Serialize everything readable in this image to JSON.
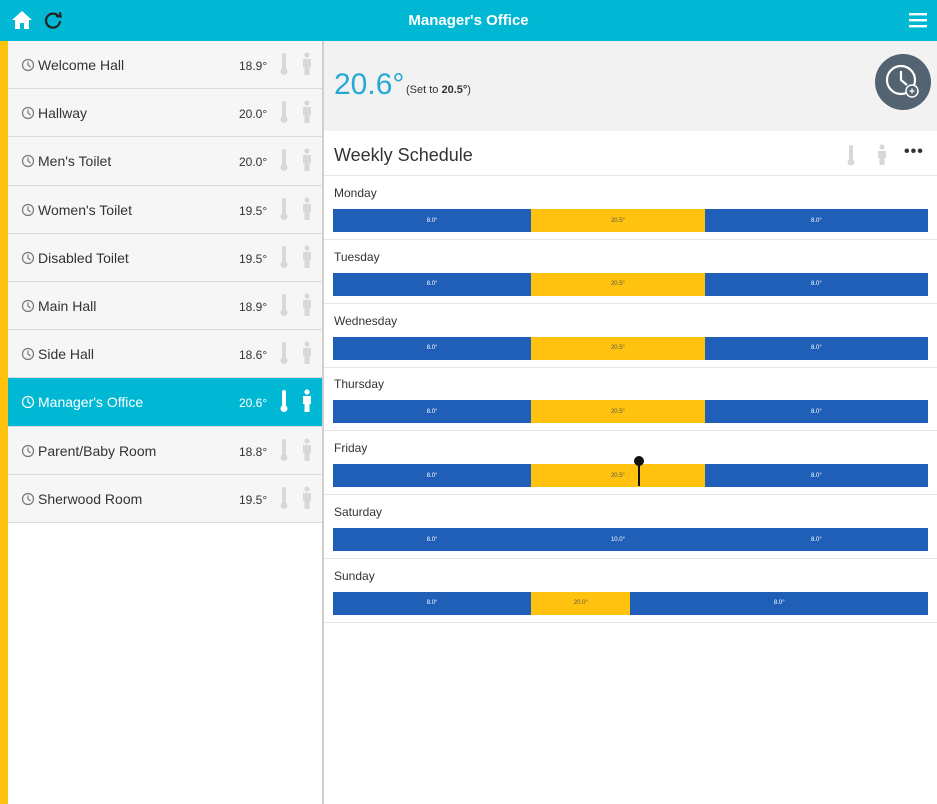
{
  "header": {
    "title": "Manager's Office"
  },
  "rooms": [
    {
      "name": "Welcome Hall",
      "temp": "18.9°"
    },
    {
      "name": "Hallway",
      "temp": "20.0°"
    },
    {
      "name": "Men's Toilet",
      "temp": "20.0°"
    },
    {
      "name": "Women's Toilet",
      "temp": "19.5°"
    },
    {
      "name": "Disabled Toilet",
      "temp": "19.5°"
    },
    {
      "name": "Main Hall",
      "temp": "18.9°"
    },
    {
      "name": "Side Hall",
      "temp": "18.6°"
    },
    {
      "name": "Manager's Office",
      "temp": "20.6°"
    },
    {
      "name": "Parent/Baby Room",
      "temp": "18.8°"
    },
    {
      "name": "Sherwood Room",
      "temp": "19.5°"
    }
  ],
  "current": {
    "temp": "20.6°",
    "set_prefix": "(Set to ",
    "set_value": "20.5°",
    "set_suffix": ")"
  },
  "schedule": {
    "title": "Weekly Schedule",
    "more": "•••",
    "days": [
      {
        "name": "Monday",
        "segments": [
          {
            "label": "8.0°",
            "frac": 0.333,
            "kind": "blue"
          },
          {
            "label": "20.5°",
            "frac": 0.292,
            "kind": "yellow"
          },
          {
            "label": "8.0°",
            "frac": 0.375,
            "kind": "blue"
          }
        ]
      },
      {
        "name": "Tuesday",
        "segments": [
          {
            "label": "8.0°",
            "frac": 0.333,
            "kind": "blue"
          },
          {
            "label": "20.5°",
            "frac": 0.292,
            "kind": "yellow"
          },
          {
            "label": "8.0°",
            "frac": 0.375,
            "kind": "blue"
          }
        ]
      },
      {
        "name": "Wednesday",
        "segments": [
          {
            "label": "8.0°",
            "frac": 0.333,
            "kind": "blue"
          },
          {
            "label": "20.5°",
            "frac": 0.292,
            "kind": "yellow"
          },
          {
            "label": "8.0°",
            "frac": 0.375,
            "kind": "blue"
          }
        ]
      },
      {
        "name": "Thursday",
        "segments": [
          {
            "label": "8.0°",
            "frac": 0.333,
            "kind": "blue"
          },
          {
            "label": "20.5°",
            "frac": 0.292,
            "kind": "yellow"
          },
          {
            "label": "8.0°",
            "frac": 0.375,
            "kind": "blue"
          }
        ]
      },
      {
        "name": "Friday",
        "marker": 0.513,
        "segments": [
          {
            "label": "8.0°",
            "frac": 0.333,
            "kind": "blue"
          },
          {
            "label": "20.5°",
            "frac": 0.292,
            "kind": "yellow"
          },
          {
            "label": "8.0°",
            "frac": 0.375,
            "kind": "blue"
          }
        ]
      },
      {
        "name": "Saturday",
        "segments": [
          {
            "label": "8.0°",
            "frac": 0.333,
            "kind": "blue"
          },
          {
            "label": "10.0°",
            "frac": 0.292,
            "kind": "blue"
          },
          {
            "label": "8.0°",
            "frac": 0.375,
            "kind": "blue"
          }
        ]
      },
      {
        "name": "Sunday",
        "segments": [
          {
            "label": "8.0°",
            "frac": 0.333,
            "kind": "blue"
          },
          {
            "label": "20.0°",
            "frac": 0.167,
            "kind": "yellow"
          },
          {
            "label": "8.0°",
            "frac": 0.5,
            "kind": "blue"
          }
        ]
      }
    ]
  },
  "colors": {
    "topbar": "#00b8d4",
    "schedule_blue": "#1f5fb8",
    "schedule_yellow": "#ffc20e"
  }
}
